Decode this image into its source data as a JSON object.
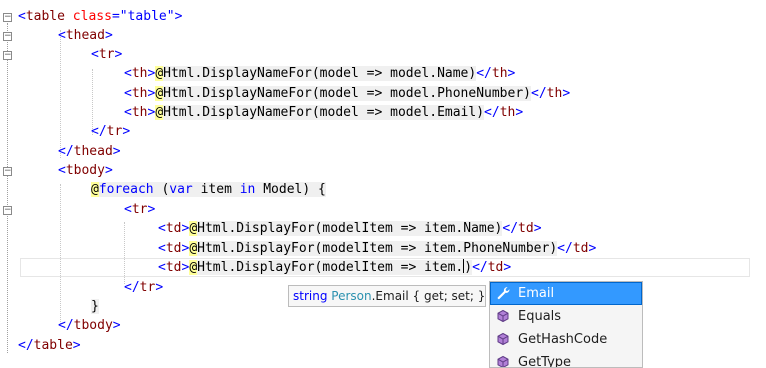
{
  "code": {
    "l1": {
      "open": "<",
      "tag": "table",
      "attr": "class",
      "eq": "=",
      "val": "\"table\"",
      "close": ">"
    },
    "l2": {
      "open": "<",
      "tag": "thead",
      "close": ">"
    },
    "l3": {
      "open": "<",
      "tag": "tr",
      "close": ">"
    },
    "l4": {
      "open": "<",
      "tag": "th",
      "close": ">",
      "at": "@",
      "expr": "Html.DisplayNameFor(model => model.Name)",
      "endopen": "</",
      "endtag": "th",
      "endclose": ">"
    },
    "l5": {
      "open": "<",
      "tag": "th",
      "close": ">",
      "at": "@",
      "expr": "Html.DisplayNameFor(model => model.PhoneNumber)",
      "endopen": "</",
      "endtag": "th",
      "endclose": ">"
    },
    "l6": {
      "open": "<",
      "tag": "th",
      "close": ">",
      "at": "@",
      "expr": "Html.DisplayNameFor(model => model.Email)",
      "endopen": "</",
      "endtag": "th",
      "endclose": ">"
    },
    "l7": {
      "open": "</",
      "tag": "tr",
      "close": ">"
    },
    "l8": {
      "open": "</",
      "tag": "thead",
      "close": ">"
    },
    "l9": {
      "open": "<",
      "tag": "tbody",
      "close": ">"
    },
    "l10": {
      "at": "@",
      "kw1": "foreach",
      "p1": " (",
      "kw2": "var",
      "p2": " item ",
      "kw3": "in",
      "p3": " Model) {"
    },
    "l11": {
      "open": "<",
      "tag": "tr",
      "close": ">"
    },
    "l12": {
      "open": "<",
      "tag": "td",
      "close": ">",
      "at": "@",
      "expr": "Html.DisplayFor(modelItem => item.Name)",
      "endopen": "</",
      "endtag": "td",
      "endclose": ">"
    },
    "l13": {
      "open": "<",
      "tag": "td",
      "close": ">",
      "at": "@",
      "expr": "Html.DisplayFor(modelItem => item.PhoneNumber)",
      "endopen": "</",
      "endtag": "td",
      "endclose": ">"
    },
    "l14": {
      "open": "<",
      "tag": "td",
      "close": ">",
      "at": "@",
      "expr": "Html.DisplayFor(modelItem => item.)",
      "endopen": "</",
      "endtag": "td",
      "endclose": ">"
    },
    "l15": {
      "open": "</",
      "tag": "tr",
      "close": ">"
    },
    "l16": {
      "brace": "}"
    },
    "l17": {
      "open": "</",
      "tag": "tbody",
      "close": ">"
    },
    "l18": {
      "open": "</",
      "tag": "table",
      "close": ">"
    }
  },
  "tooltip": {
    "kw": "string",
    "type": "Person",
    "member": ".Email",
    "rest": " { get; set; }"
  },
  "completion": {
    "items": [
      {
        "label": "Email",
        "icon": "wrench-icon",
        "selected": true
      },
      {
        "label": "Equals",
        "icon": "method-cube-icon",
        "selected": false
      },
      {
        "label": "GetHashCode",
        "icon": "method-cube-icon",
        "selected": false
      },
      {
        "label": "GetType",
        "icon": "method-cube-icon",
        "selected": false
      }
    ]
  },
  "colors": {
    "tag": "#800000",
    "attribute": "#ff0000",
    "string": "#0000ff",
    "keyword": "#0000ff",
    "razor_highlight": "#ffff99",
    "selection": "#3399ff",
    "type_name": "#2b91af"
  }
}
